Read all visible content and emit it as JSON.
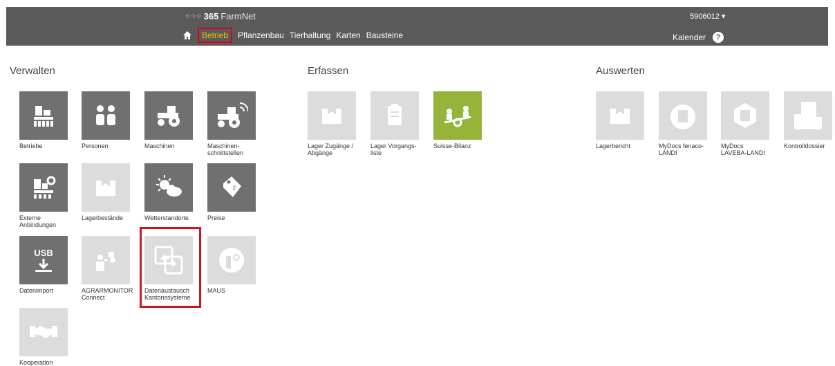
{
  "header": {
    "brand_mark": "⁘⁘⁘",
    "brand_bold": "365",
    "brand_rest": "FarmNet",
    "user_id": "5906012 ▾",
    "calendar_label": "Kalender",
    "help_label": "?",
    "nav": [
      "Betrieb",
      "Pflanzenbau",
      "Tierhaltung",
      "Karten",
      "Bausteine"
    ]
  },
  "sections": {
    "verwalten": "Verwalten",
    "erfassen": "Erfassen",
    "auswerten": "Auswerten"
  },
  "tiles": {
    "betriebe": "Betriebe",
    "personen": "Personen",
    "maschinen": "Maschinen",
    "maschinen_schnitt": "Maschinen-\nschnittstellen",
    "externe": "Externe\nAnbindungen",
    "lagerbestaende": "Lagerbestände",
    "wetterstandorte": "Wetterstandorte",
    "preise": "Preise",
    "datenimport": "Datenimport",
    "usb": "USB",
    "agrarmonitor": "AGRARMONITOR\nConnect",
    "datenaustausch": "Datenaustausch\nKantonssysteme",
    "maus": "MAUS",
    "kooperation": "Kooperation",
    "lager_zugaenge": "Lager Zugänge /\nAbgänge",
    "lager_vorgangs": "Lager Vorgangs-\nliste",
    "suisse_bilanz": "Suisse-Bilanz",
    "lagerbericht": "Lagerbericht",
    "mydocs_fenaco": "MyDocs fenaco-\nLANDI",
    "mydocs_laveba": "MyDocs\nLAVEBA-LANDI",
    "kontrolldossier": "Kontrolldossier"
  },
  "colors": {
    "header_bg": "#5a5a5a",
    "tile_dark": "#707070",
    "tile_light": "#dcdcdc",
    "tile_green": "#97b43a",
    "active_nav": "#f0c000",
    "highlight": "#d0141e"
  }
}
